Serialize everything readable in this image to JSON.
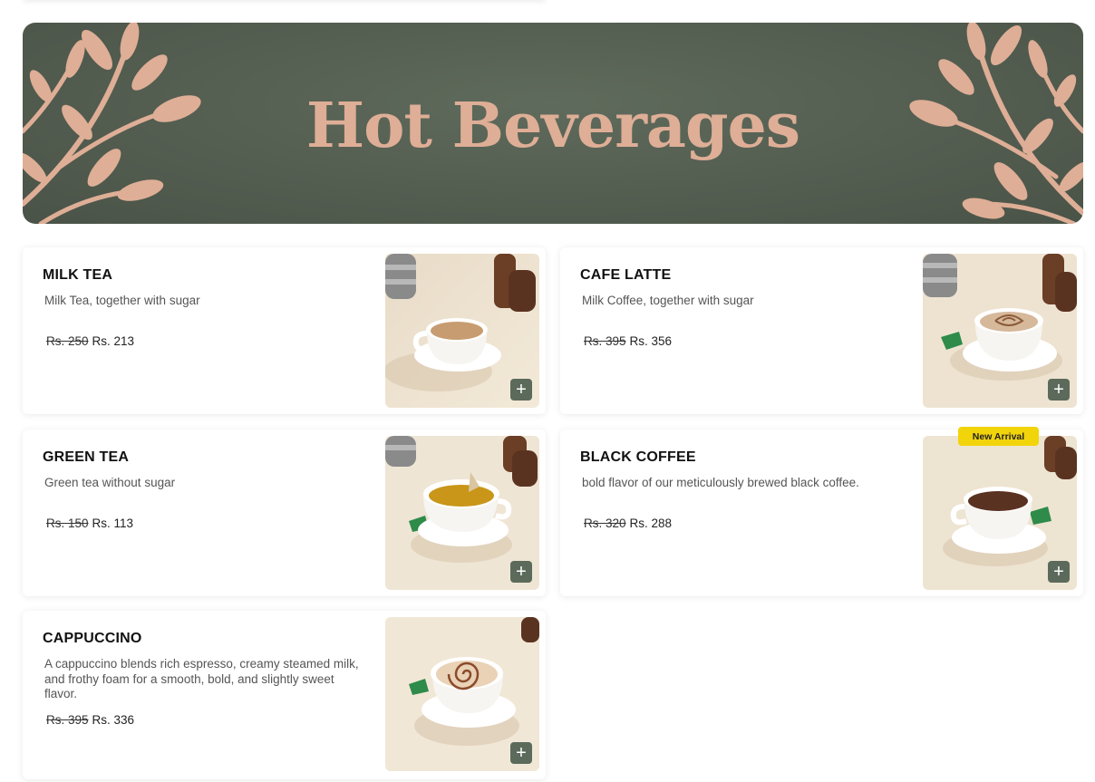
{
  "category": {
    "title": "Hot Beverages"
  },
  "colors": {
    "banner_bg": "#535d50",
    "banner_accent": "#deae96",
    "add_button": "#5b6a5b",
    "badge": "#f2d40b"
  },
  "items": [
    {
      "name": "MILK TEA",
      "description": "Milk Tea, together with sugar",
      "old_price": "Rs. 250",
      "price": "Rs. 213",
      "add_icon": "plus-icon"
    },
    {
      "name": "CAFE LATTE",
      "description": "Milk Coffee, together with sugar",
      "old_price": "Rs. 395",
      "price": "Rs. 356",
      "add_icon": "plus-icon"
    },
    {
      "name": "GREEN TEA",
      "description": "Green tea without sugar",
      "old_price": "Rs. 150",
      "price": "Rs. 113",
      "add_icon": "plus-icon"
    },
    {
      "name": "BLACK COFFEE",
      "description": "bold flavor of our meticulously brewed black coffee.",
      "old_price": "Rs. 320",
      "price": "Rs. 288",
      "badge": "New Arrival",
      "add_icon": "plus-icon"
    },
    {
      "name": "CAPPUCCINO",
      "description": "A cappuccino blends rich espresso, creamy steamed milk, and frothy foam for a smooth, bold, and slightly sweet flavor.",
      "old_price": "Rs. 395",
      "price": "Rs. 336",
      "add_icon": "plus-icon"
    }
  ]
}
